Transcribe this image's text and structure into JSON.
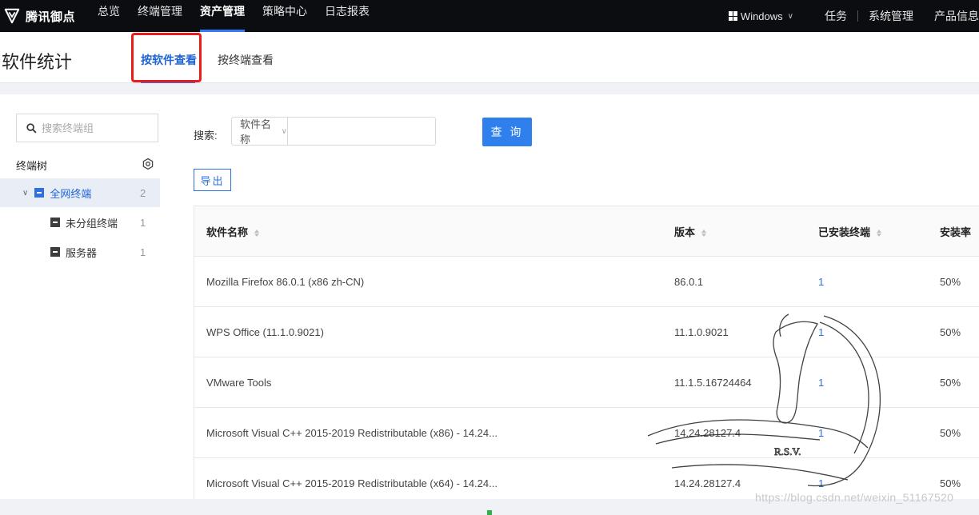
{
  "topnav": {
    "brand": "腾讯御点",
    "items": [
      {
        "label": "总览",
        "active": false
      },
      {
        "label": "终端管理",
        "active": false
      },
      {
        "label": "资产管理",
        "active": true
      },
      {
        "label": "策略中心",
        "active": false
      },
      {
        "label": "日志报表",
        "active": false
      }
    ],
    "os_switch": "Windows",
    "task": "任务",
    "system": "系统管理",
    "product": "产品信息"
  },
  "subheader": {
    "title": "软件统计",
    "tabs": [
      {
        "label": "按软件查看",
        "active": true
      },
      {
        "label": "按终端查看",
        "active": false
      }
    ]
  },
  "sidebar": {
    "search_placeholder": "搜索终端组",
    "tree_title": "终端树",
    "nodes": [
      {
        "label": "全网终端",
        "count": "2"
      },
      {
        "label": "未分组终端",
        "count": "1"
      },
      {
        "label": "服务器",
        "count": "1"
      }
    ]
  },
  "main": {
    "search_label": "搜索:",
    "search_field": "软件名称",
    "query_button": "查 询",
    "export_button": "导出",
    "columns": [
      "软件名称",
      "版本",
      "已安装终端",
      "安装率"
    ],
    "rows": [
      {
        "name": "Mozilla Firefox 86.0.1 (x86 zh-CN)",
        "version": "86.0.1",
        "installed": "1",
        "rate": "50%"
      },
      {
        "name": "WPS Office (11.1.0.9021)",
        "version": "11.1.0.9021",
        "installed": "1",
        "rate": "50%"
      },
      {
        "name": "VMware Tools",
        "version": "11.1.5.16724464",
        "installed": "1",
        "rate": "50%"
      },
      {
        "name": "Microsoft Visual C++ 2015-2019 Redistributable (x86) - 14.24...",
        "version": "14.24.28127.4",
        "installed": "1",
        "rate": "50%"
      },
      {
        "name": "Microsoft Visual C++ 2015-2019 Redistributable (x64) - 14.24...",
        "version": "14.24.28127.4",
        "installed": "1",
        "rate": "50%"
      }
    ]
  },
  "watermark": {
    "text": "https://blog.csdn.net/weixin_51167520",
    "emblem_text": "R.S.V."
  },
  "colors": {
    "nav_bg": "#0b0d10",
    "accent": "#2f6fe0",
    "primary_button": "#2f80ed",
    "highlight": "#ea1c1c"
  }
}
